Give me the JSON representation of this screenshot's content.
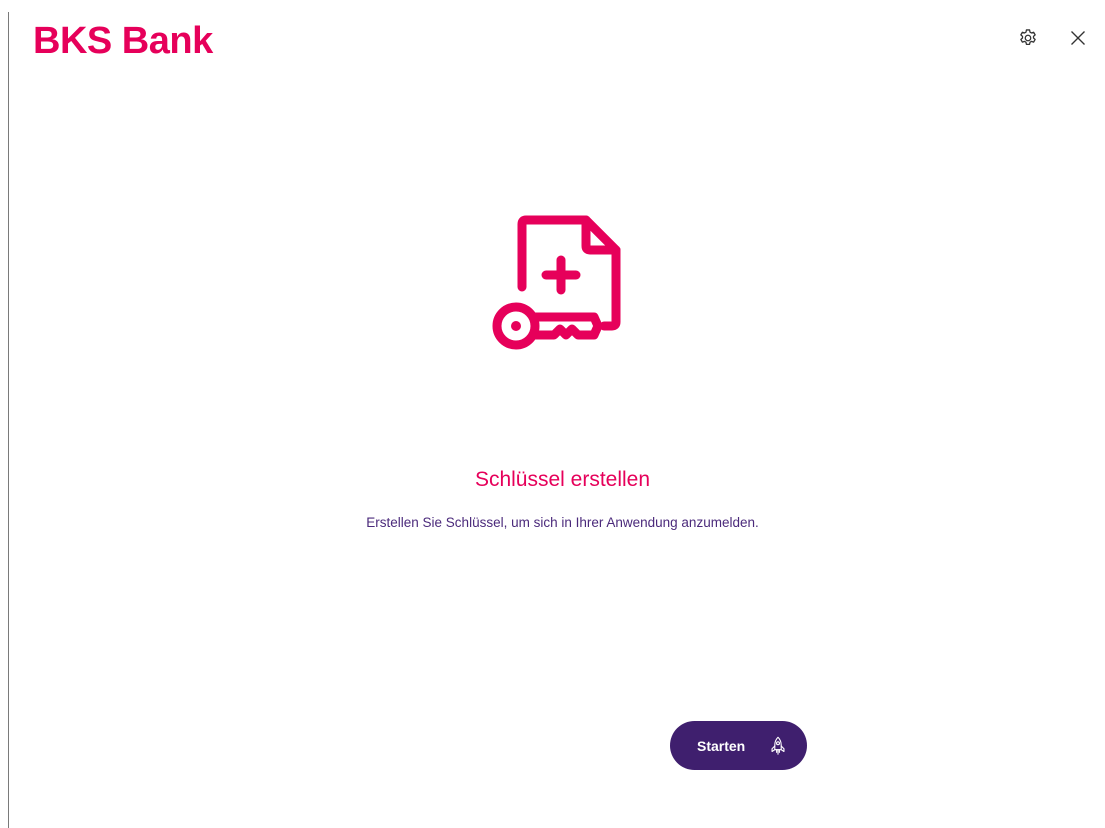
{
  "header": {
    "logo_text": "BKS Bank",
    "settings_icon": "gear-icon",
    "close_icon": "close-icon"
  },
  "hero": {
    "icon": "document-key-plus-icon",
    "title": "Schlüssel erstellen",
    "description": "Erstellen Sie Schlüssel, um sich in Ihrer Anwendung anzumelden."
  },
  "actions": {
    "start_label": "Starten",
    "start_icon": "rocket-icon"
  },
  "colors": {
    "brand": "#e6005a",
    "primary": "#3f1f6e",
    "text_secondary": "#4b2a7b"
  }
}
